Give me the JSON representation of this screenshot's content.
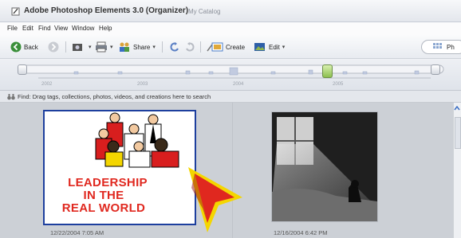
{
  "window": {
    "title": "Adobe Photoshop Elements 3.0 (Organizer)",
    "catalog": "My Catalog"
  },
  "menu": {
    "items": [
      "File",
      "Edit",
      "Find",
      "View",
      "Window",
      "Help"
    ]
  },
  "toolbar": {
    "back_label": "Back",
    "share_label": "Share",
    "create_label": "Create",
    "edit_label": "Edit",
    "view_label": "Ph"
  },
  "timeline": {
    "years": [
      "2002",
      "2003",
      "2004",
      "2005"
    ]
  },
  "findbar": {
    "text": "Find: Drag tags, collections, photos, videos, and creations here to search"
  },
  "photos": [
    {
      "caption": "12/22/2004 7:05 AM",
      "poster_lines": [
        "LEADERSHIP",
        "IN THE",
        "REAL WORLD"
      ]
    },
    {
      "caption": "12/16/2004 6:42 PM"
    }
  ],
  "colors": {
    "selection_border": "#1d3f9e",
    "poster_text": "#e0281f",
    "pointer_fill": "#e0281f",
    "pointer_outline": "#f4d600"
  }
}
